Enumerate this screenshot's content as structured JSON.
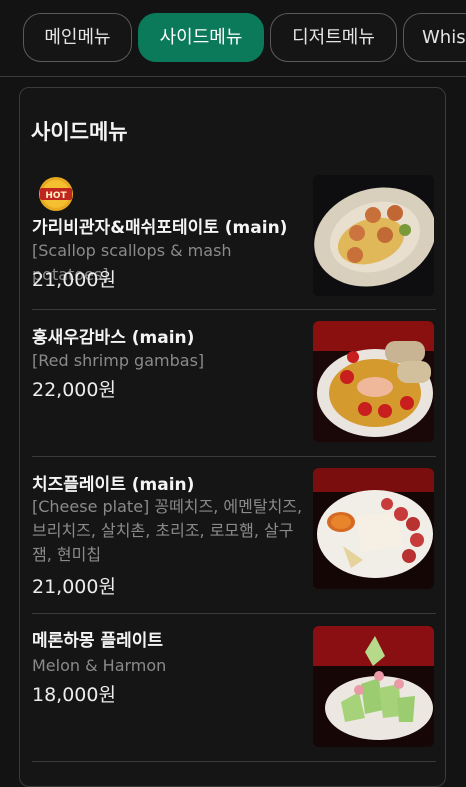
{
  "tabs": [
    {
      "label": "메인메뉴",
      "active": false
    },
    {
      "label": "사이드메뉴",
      "active": true
    },
    {
      "label": "디저트메뉴",
      "active": false
    },
    {
      "label": "Whis",
      "active": false
    }
  ],
  "section": {
    "title": "사이드메뉴"
  },
  "badge": {
    "text": "HOT"
  },
  "items": [
    {
      "name": "가리비관자&매쉬포테이토 (main)",
      "desc": "[Scallop scallops & mash potatoes]",
      "price": "21,000원",
      "image": "scallop-dish"
    },
    {
      "name": "홍새우감바스 (main)",
      "desc": "[Red shrimp gambas]",
      "price": "22,000원",
      "image": "gambas-dish"
    },
    {
      "name": "치즈플레이트 (main)",
      "desc": "[Cheese plate] 꽁떼치즈, 에멘탈치즈, 브리치즈, 살치촌, 초리조, 로모햄, 살구잼, 현미칩",
      "price": "21,000원",
      "image": "cheese-plate"
    },
    {
      "name": "메론하몽 플레이트",
      "desc": "Melon & Harmon",
      "price": "18,000원",
      "image": "melon-plate"
    }
  ],
  "colors": {
    "accent": "#0b7a5a",
    "background": "#131313"
  }
}
